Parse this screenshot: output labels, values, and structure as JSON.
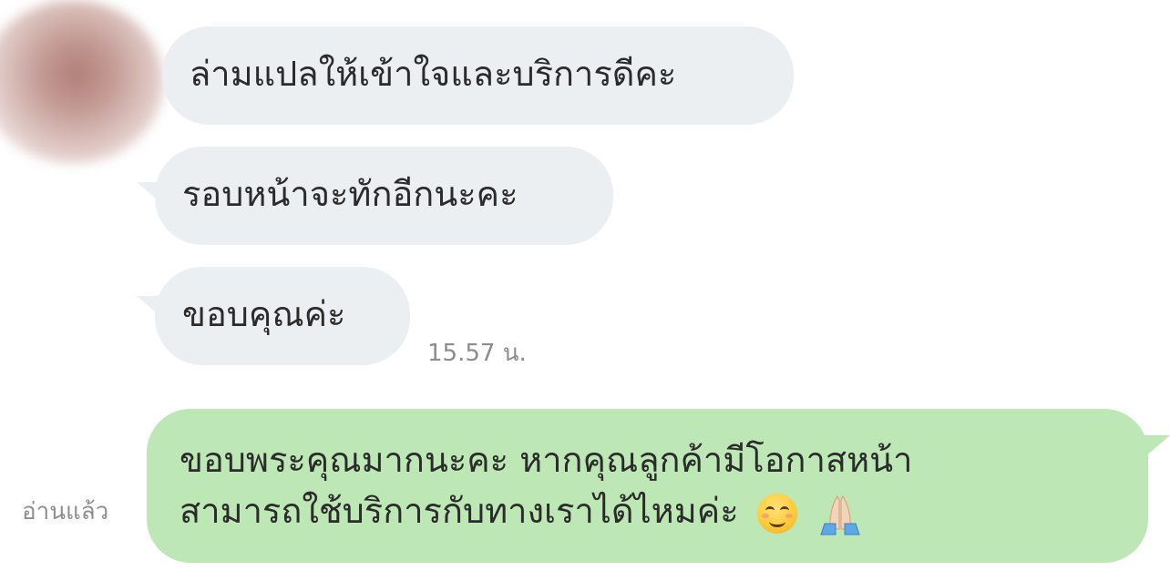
{
  "conversation": {
    "contact": {
      "avatar_icon": "blurred-avatar"
    },
    "incoming": [
      {
        "text": "ล่ามแปลให้เข้าใจและบริการดีคะ"
      },
      {
        "text": "รอบหน้าจะทักอีกนะคะ"
      },
      {
        "text": "ขอบคุณค่ะ",
        "time": "15.57 น."
      }
    ],
    "outgoing": [
      {
        "line1": "ขอบพระคุณมากนะคะ หากคุณลูกค้ามีโอกาสหน้า",
        "line2": "สามารถใช้บริการกับทางเราได้ไหมค่ะ",
        "emojis": [
          "smiling-face-icon",
          "folded-hands-icon"
        ],
        "status": "อ่านแล้ว"
      }
    ]
  },
  "colors": {
    "incoming_bubble": "#eceff1",
    "outgoing_bubble": "#bde8b5",
    "meta_text": "#8d8d8d",
    "message_text": "#2b2b2b"
  }
}
